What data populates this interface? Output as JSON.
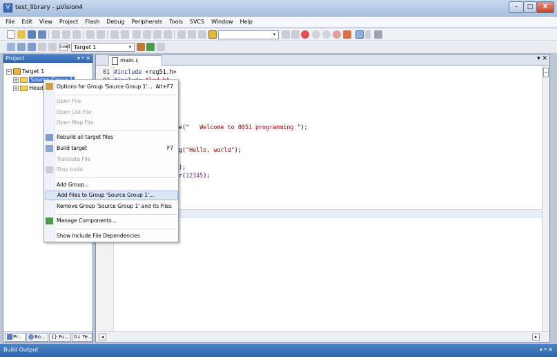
{
  "window": {
    "title": "test_library - µVision4",
    "minimize_label": "–",
    "maximize_label": "□",
    "close_label": "X"
  },
  "menubar": {
    "items": [
      "File",
      "Edit",
      "View",
      "Project",
      "Flash",
      "Debug",
      "Peripherals",
      "Tools",
      "SVCS",
      "Window",
      "Help"
    ]
  },
  "toolbar2": {
    "load_label": "Load",
    "target_combo_value": "Target 1"
  },
  "project_panel": {
    "title": "Project",
    "header_controls": "▾ ᵠ ✕",
    "tree": {
      "root_label": "Target 1",
      "group1_label": "Source Group 1",
      "group2_label": "Head"
    },
    "tabs": [
      "Pr...",
      "Bo...",
      "{} Fu...",
      "0↓ Te..."
    ]
  },
  "editor": {
    "tab_label": "main.c",
    "close_label": "▾ ✕",
    "line_numbers": [
      "01",
      "02"
    ],
    "code": {
      "line1_kw": "#include",
      "line1_rest": " <reg51.h>",
      "line2_kw": "#include",
      "line2_str": " \"lcd.h\"",
      "line3_rest": "e(\"",
      "line3_str": "   Welcome to 8051 programming ",
      "line3_end": "\");",
      "line4_rest": "g(",
      "line4_str": "\"Hello, world\"",
      "line4_end": ");",
      "line5": ");",
      "line6_rest": "r(",
      "line6_num": "12345",
      "line6_end": ");"
    }
  },
  "context_menu": {
    "options_label": "Options for Group 'Source Group 1'...",
    "options_shortcut": "Alt+F7",
    "open_file": "Open File",
    "open_list_file": "Open List File",
    "open_map_file": "Open Map File",
    "rebuild_all": "Rebuild all target files",
    "build_target": "Build target",
    "build_shortcut": "F7",
    "translate_file": "Translate File",
    "stop_build": "Stop build",
    "add_group": "Add Group...",
    "add_files": "Add Files to Group 'Source Group 1'...",
    "remove_group": "Remove Group 'Source Group 1' and its Files",
    "manage_components": "Manage Components...",
    "show_include": "Show Include File Dependencies"
  },
  "build_output": {
    "title": "Build Output",
    "controls": "▾ ᵠ ✕"
  }
}
